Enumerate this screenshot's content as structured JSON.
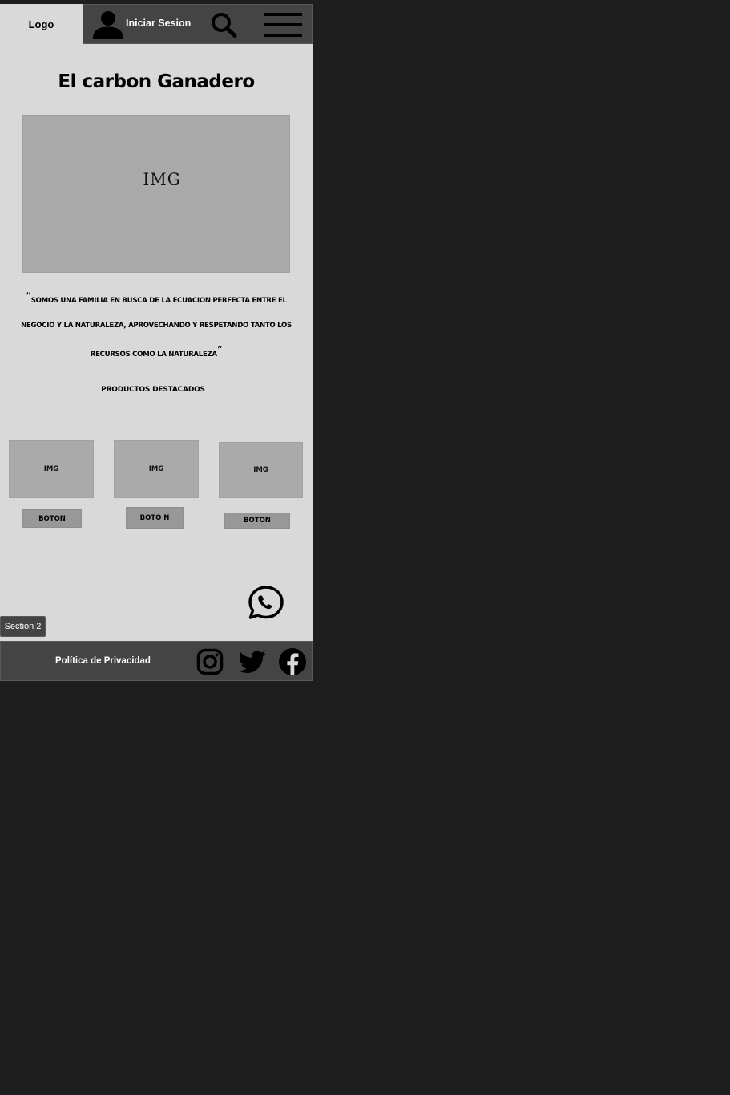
{
  "header": {
    "logo_text": "Logo",
    "login_label": "Iniciar Sesion",
    "icons": [
      "user-icon",
      "search-icon",
      "menu-icon"
    ]
  },
  "main": {
    "title": "El carbon Ganadero",
    "hero_image_label": "IMG",
    "quote_open": "“",
    "quote_text": "SOMOS UNA FAMILIA EN BUSCA DE LA ECUACION PERFECTA ENTRE EL NEGOCIO Y LA NATURALEZA, APROVECHANDO Y RESPETANDO TANTO LOS RECURSOS COMO LA NATURALEZA",
    "quote_close": "”",
    "featured_heading": "PRODUCTOS DESTACADOS",
    "products": [
      {
        "image_label": "IMG",
        "button_label": "BOTON"
      },
      {
        "image_label": "IMG",
        "button_label": "BOTO N"
      },
      {
        "image_label": "IMG",
        "button_label": "BOTON"
      }
    ],
    "section_tag": "Section 2",
    "floating_icon": "whatsapp-icon"
  },
  "footer": {
    "privacy_label": "Política de Privacidad",
    "social_icons": [
      "instagram-icon",
      "twitter-icon",
      "facebook-icon"
    ]
  },
  "colors": {
    "canvas_background": "#1e1e1e",
    "page_background": "#d9d9d9",
    "bar_background": "#444444",
    "placeholder_gray": "#aaaaaa",
    "button_gray": "#989898"
  }
}
